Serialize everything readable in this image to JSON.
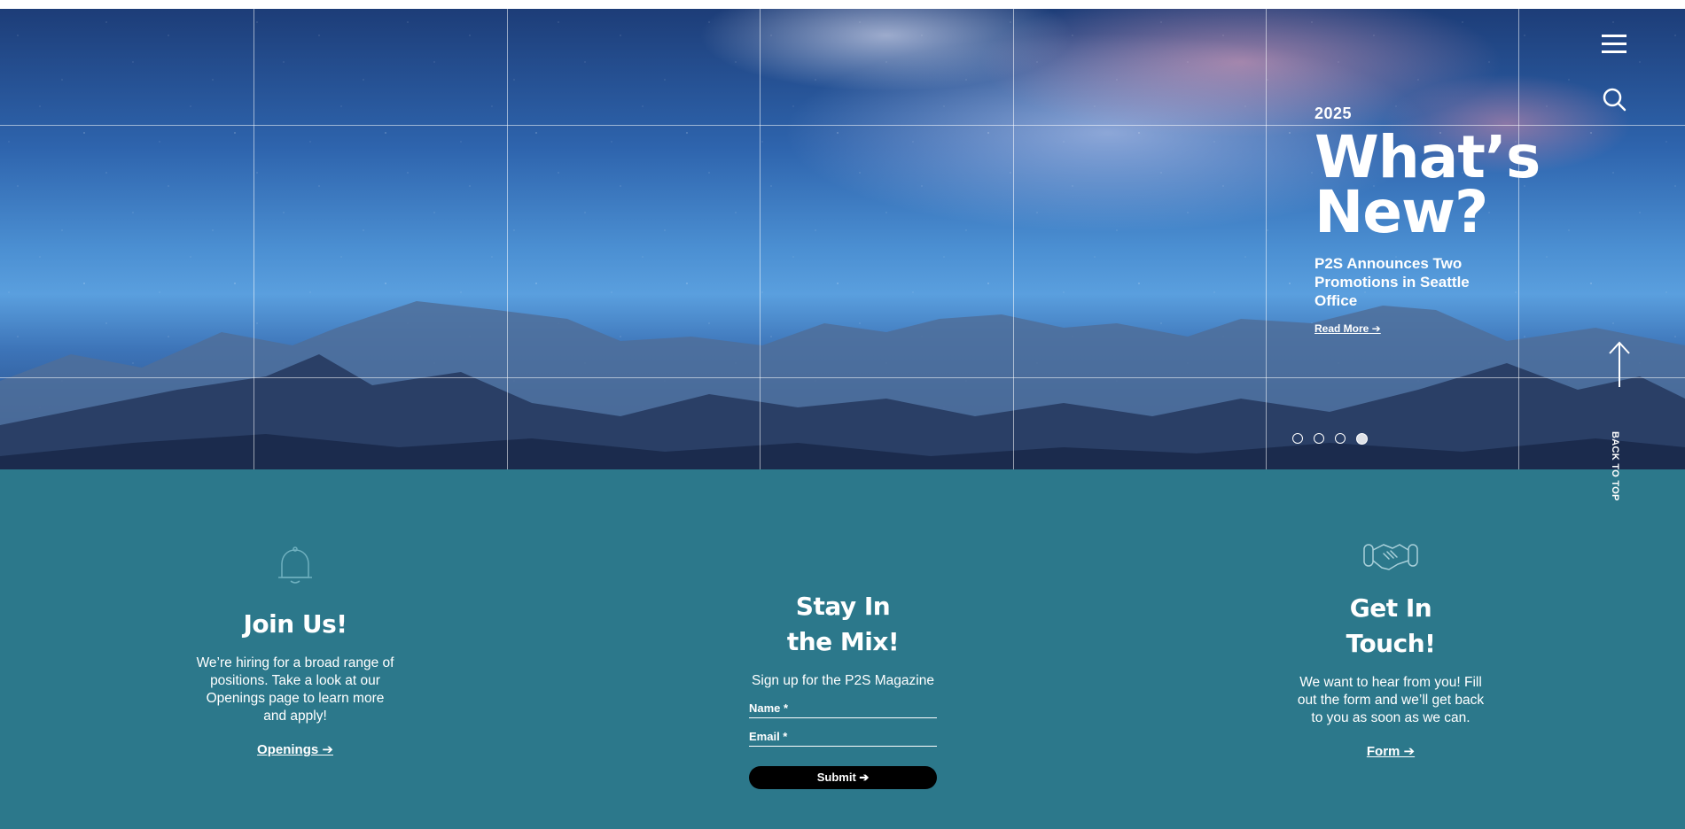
{
  "hero": {
    "year": "2025",
    "title": "What’s New?",
    "headline": "P2S Announces Two Promotions in Seattle Office",
    "read_more": "Read More ➔",
    "slides": 4,
    "active_slide": 4,
    "back_to_top": "BACK TO TOP"
  },
  "join": {
    "title": "Join Us!",
    "body": "We’re hiring for a broad range of positions. Take a look at our Openings page to learn more and apply!",
    "link": "Openings ➔"
  },
  "mix": {
    "title": "Stay In the Mix!",
    "body": "Sign up for the P2S Magazine",
    "name_placeholder": "Name *",
    "email_placeholder": "Email *",
    "submit": "Submit ➔"
  },
  "touch": {
    "title": "Get In Touch!",
    "body": "We want to hear from you! Fill out the form and we’ll get back to you as soon as we can.",
    "link": "Form ➔"
  },
  "icons": {
    "menu": "hamburger-menu-icon",
    "search": "search-icon",
    "back_to_top": "arrow-up-icon",
    "join": "bell-icon",
    "touch": "handshake-icon"
  },
  "colors": {
    "band": "#2c788b",
    "button": "#000000",
    "text": "#ffffff"
  }
}
